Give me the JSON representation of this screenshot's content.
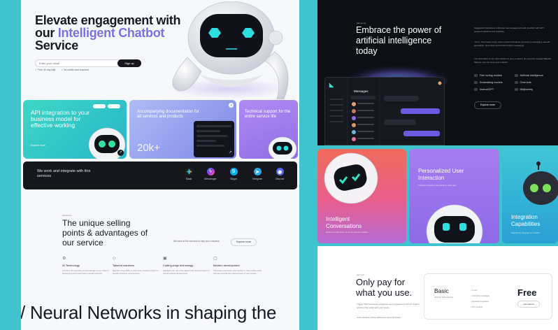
{
  "hero": {
    "title_pre": "Elevate engagement with our ",
    "title_accent": "Intelligent Chatbot",
    "title_post": " Service",
    "email_placeholder": "Enter your email",
    "signup_label": "Sign up",
    "check_1": "Free 30 day trial",
    "check_2": "No credit card required"
  },
  "cards": {
    "api": {
      "title": "API integration to your business model for effective working",
      "link": "Explore more"
    },
    "docs": {
      "title": "Accompanying documentation for all services and products",
      "big_number": "20k+"
    },
    "tech": {
      "title": "Technical support for the entire service life"
    }
  },
  "integrations": {
    "title": "We work and integrate with this services",
    "services": [
      "Slack",
      "Messenger",
      "Skype",
      "Telegram",
      "Discord"
    ]
  },
  "usp": {
    "tag": "[services]",
    "title": "The unique selling points & advantages of our service",
    "middle_text": "We have all the services to help your business",
    "button": "Explore more",
    "features": [
      {
        "name": "AI Technology",
        "desc": "Combine the expertise and knowledge of your team in developing and implementing neural networks"
      },
      {
        "name": "Tailored solutions",
        "desc": "Maintain easy ability to customize solutions based on specific business requirements"
      },
      {
        "name": "Cutting-edge technology",
        "desc": "Highlight your use of the latest tools and techniques in neural network development"
      },
      {
        "name": "Modern development",
        "desc": "Showcase successful case studies or client testimonials that demonstrate the effectiveness of your service"
      }
    ]
  },
  "neural_heading": "/ Neural Networks in shaping the",
  "embrace": {
    "tag": "[about us]",
    "title": "Embrace the power of artificial intelligence today",
    "para_1": "Suggested businesses enhanced user engagement and creativity with GPT-powered solutions and expertise.",
    "para_2": "You're, have learnt every system performed about processing messaging, speech-generation, text output and transformation messaging.",
    "para_3": "The best effect on the right solution to your company. By using the Google Material Planner, you can keep your projects.",
    "features": [
      "Fine tuning models",
      "Artificial intelligence",
      "Embedding models",
      "Chat bots",
      "InstructGPT",
      "Midjourney"
    ],
    "button": "Explore more",
    "app_header": "Messages"
  },
  "rcards": {
    "c1": {
      "title": "Intelligent Conversations",
      "sub": "Experience the power of our AI-powered chatbot"
    },
    "c2": {
      "title": "Personalized User Interaction",
      "sub": "Tailored interactions that adapt to each user"
    },
    "c3": {
      "title": "Integration Capabilities",
      "sub": "Seamlessly integrate our chatbot"
    }
  },
  "pricing": {
    "tag": "[pricing]",
    "title": "Only pay for what you use.",
    "desc_1": "Trigger that businesses enhanced user engagement with AI chatbot services that scale with your needs.",
    "desc_2": "Cost-effective pricing tailored to every business.",
    "plan_name": "Basic",
    "plan_sub": "Ideal for personal use",
    "plan_features": [
      "1 user",
      "Unlimited messages",
      "Standard templates",
      "24/7 support"
    ],
    "price": "Free",
    "plan_button": "Get started"
  },
  "colors": {
    "accent": "#7a72e4",
    "dark": "#16171d",
    "teal": "#3fc3cf"
  }
}
